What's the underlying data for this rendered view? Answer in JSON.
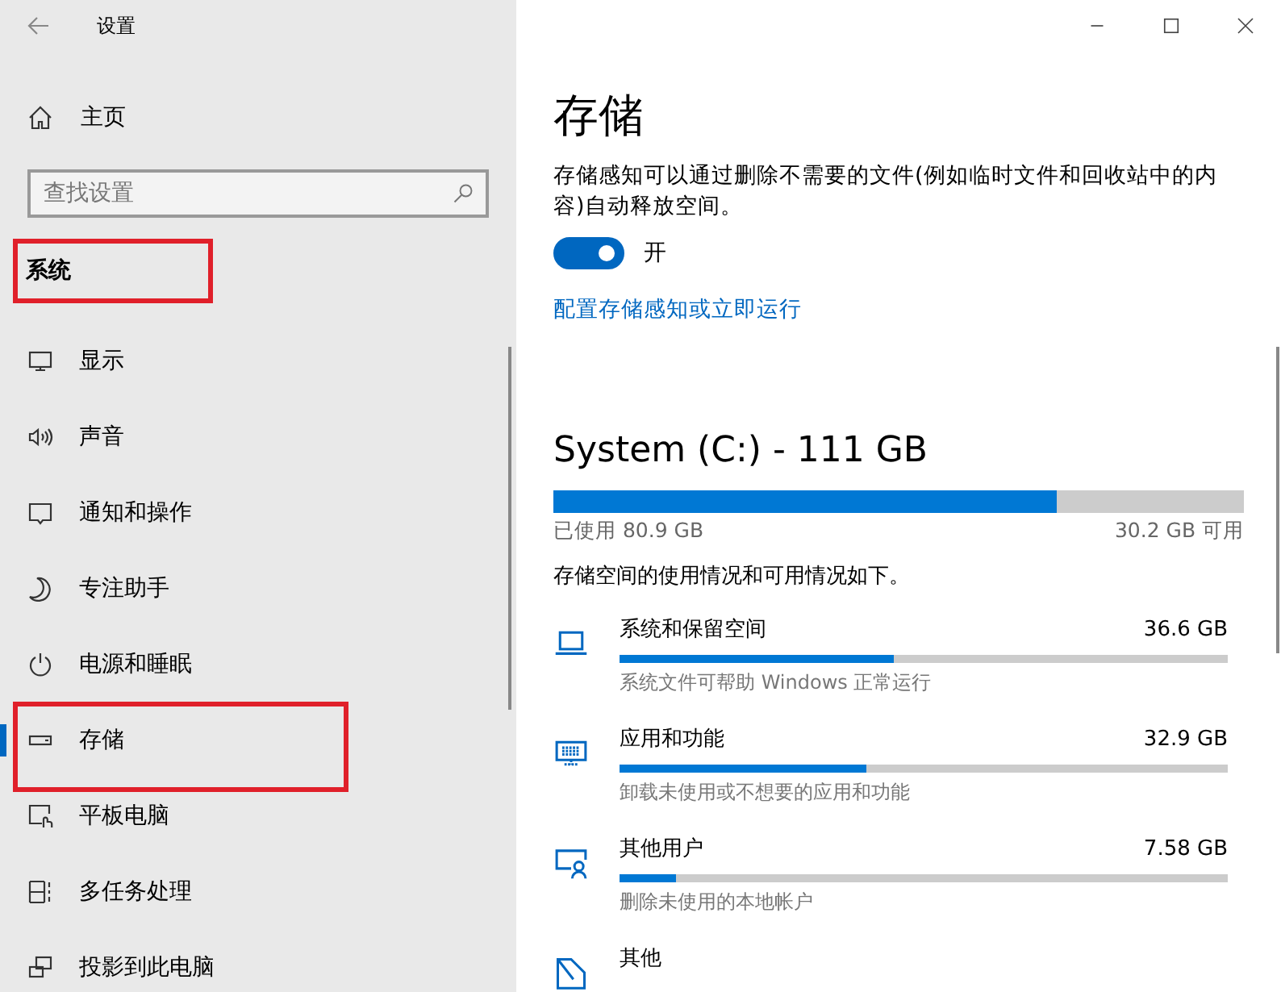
{
  "window": {
    "title": "设置"
  },
  "sidebar": {
    "home": "主页",
    "search": {
      "placeholder": "查找设置"
    },
    "section": {
      "text": "系统",
      "highlighted": true
    },
    "items": [
      {
        "label": "显示",
        "kind": "display",
        "selected": false,
        "highlighted": false
      },
      {
        "label": "声音",
        "kind": "sound",
        "selected": false,
        "highlighted": false
      },
      {
        "label": "通知和操作",
        "kind": "notify",
        "selected": false,
        "highlighted": false
      },
      {
        "label": "专注助手",
        "kind": "moon",
        "selected": false,
        "highlighted": false
      },
      {
        "label": "电源和睡眠",
        "kind": "power",
        "selected": false,
        "highlighted": false
      },
      {
        "label": "存储",
        "kind": "storage",
        "selected": true,
        "highlighted": true
      },
      {
        "label": "平板电脑",
        "kind": "tablet",
        "selected": false,
        "highlighted": false
      },
      {
        "label": "多任务处理",
        "kind": "multitask",
        "selected": false,
        "highlighted": false
      },
      {
        "label": "投影到此电脑",
        "kind": "project",
        "selected": false,
        "highlighted": false
      }
    ]
  },
  "main": {
    "title": "存储",
    "description": "存储感知可以通过删除不需要的文件(例如临时文件和回收站中的内容)自动释放空间。",
    "toggle": {
      "on": true,
      "label": "开"
    },
    "link": "配置存储感知或立即运行",
    "drive": {
      "name": "System (C:) - 111 GB",
      "level": 0.728,
      "used": "已使用 80.9 GB",
      "free": "30.2 GB 可用"
    },
    "usage_note": "存储空间的使用情况和可用情况如下。",
    "categories": [
      {
        "kind": "laptop",
        "name": "系统和保留空间",
        "size": "36.6 GB",
        "level": 0.452,
        "hint": "系统文件可帮助 Windows 正常运行"
      },
      {
        "kind": "keyboard",
        "name": "应用和功能",
        "size": "32.9 GB",
        "level": 0.407,
        "hint": "卸载未使用或不想要的应用和功能"
      },
      {
        "kind": "user",
        "name": "其他用户",
        "size": "7.58 GB",
        "level": 0.093,
        "hint": "删除未使用的本地帐户"
      },
      {
        "kind": "other",
        "name": "其他"
      }
    ]
  }
}
